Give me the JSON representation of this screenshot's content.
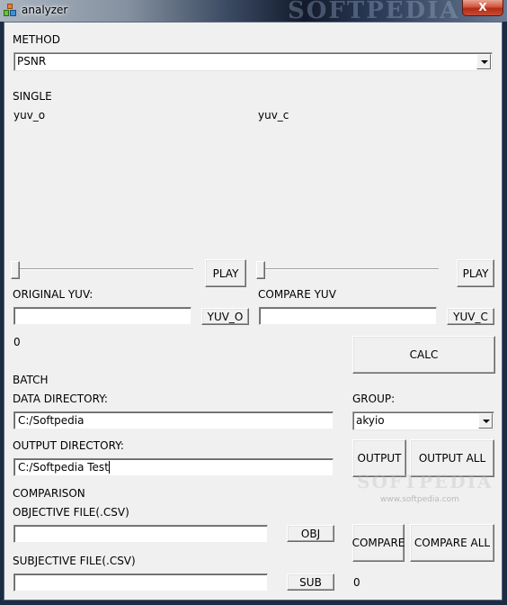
{
  "window": {
    "title": "analyzer",
    "app_icon": "blocks-icon",
    "close_label": "X"
  },
  "method": {
    "label": "METHOD",
    "selected": "PSNR"
  },
  "single": {
    "section_label": "SINGLE",
    "preview_left_label": "yuv_o",
    "preview_right_label": "yuv_c",
    "left_slider_value": 0,
    "right_slider_value": 0,
    "play_left_label": "PLAY",
    "play_right_label": "PLAY",
    "original_label": "ORIGINAL YUV:",
    "original_value": "",
    "original_button": "YUV_O",
    "compare_label": "COMPARE YUV",
    "compare_value": "",
    "compare_button": "YUV_C",
    "result_value": "0",
    "calc_button": "CALC"
  },
  "batch": {
    "section_label": "BATCH",
    "data_dir_label": "DATA DIRECTORY:",
    "data_dir_value": "C:/Softpedia",
    "group_label": "GROUP:",
    "group_selected": "akyio",
    "output_dir_label": "OUTPUT DIRECTORY:",
    "output_dir_value": "C:/Softpedia Test",
    "output_button": "OUTPUT",
    "output_all_button": "OUTPUT ALL"
  },
  "comparison": {
    "section_label": "COMPARISON",
    "objective_label": "OBJECTIVE FILE(.CSV)",
    "objective_value": "",
    "obj_button": "OBJ",
    "subjective_label": "SUBJECTIVE FILE(.CSV)",
    "subjective_value": "",
    "sub_button": "SUB",
    "compare_button": "COMPARE",
    "compare_all_button": "COMPARE ALL",
    "result_value": "0"
  },
  "watermark": {
    "title_text": "SOFTPEDIA",
    "body_text": "SOFTPEDIA",
    "url_text": "www.softpedia.com"
  }
}
